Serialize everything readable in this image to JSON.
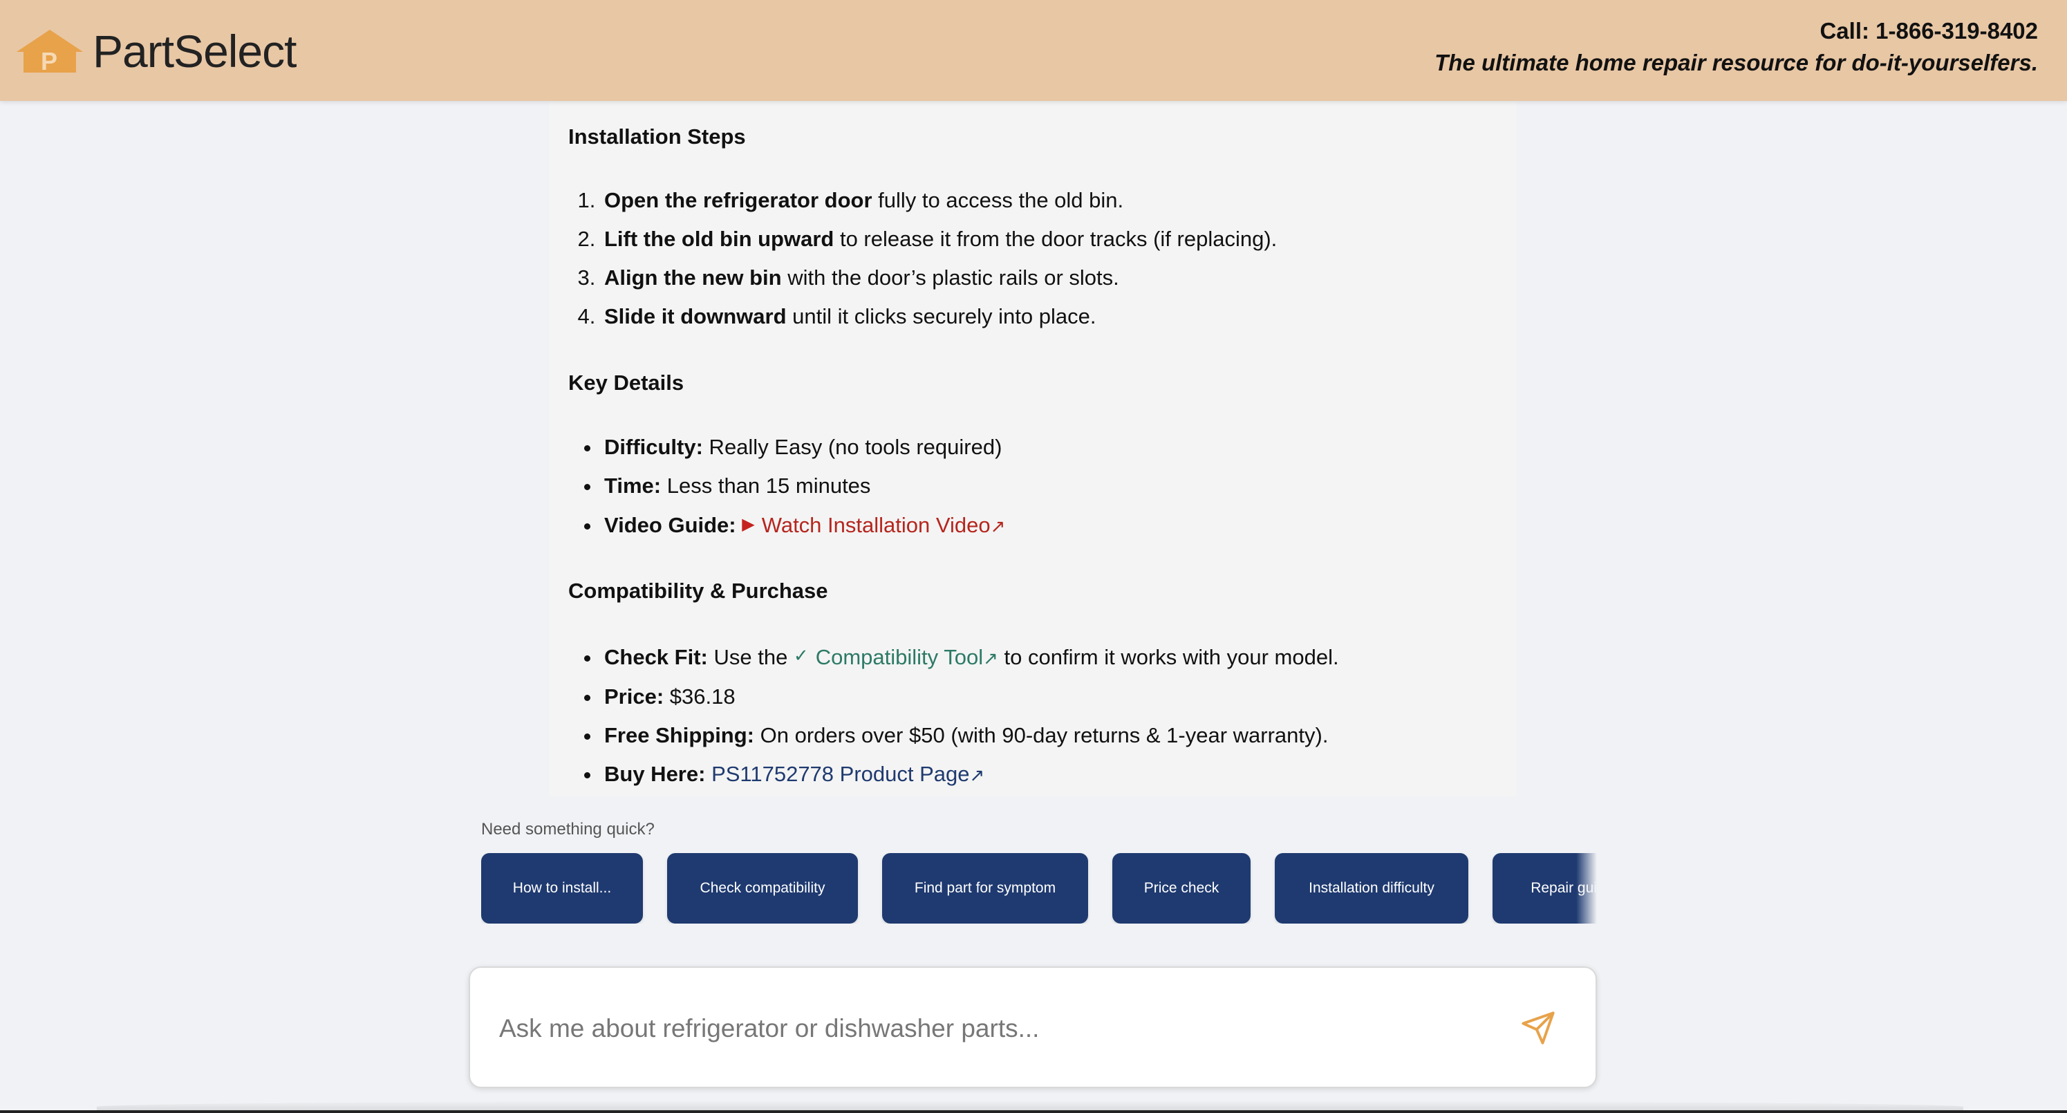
{
  "header": {
    "logo_text": "PartSelect",
    "logo_icon": "house-logo-icon",
    "call": "Call: 1-866-319-8402",
    "tagline": "The ultimate home repair resource for do-it-yourselfers."
  },
  "colors": {
    "header_bg": "#e8c7a5",
    "logo_orange": "#e8a24a",
    "chip_navy": "#1f3a70",
    "link_red": "#b5261e",
    "link_green": "#2d7a66",
    "send_orange": "#e8a24a"
  },
  "message": {
    "installation": {
      "heading": "Installation Steps",
      "steps": [
        {
          "bold": "Open the refrigerator door",
          "rest": " fully to access the old bin."
        },
        {
          "bold": "Lift the old bin upward",
          "rest": " to release it from the door tracks (if replacing)."
        },
        {
          "bold": "Align the new bin",
          "rest": " with the door’s plastic rails or slots."
        },
        {
          "bold": "Slide it downward",
          "rest": " until it clicks securely into place."
        }
      ]
    },
    "key_details": {
      "heading": "Key Details",
      "difficulty_label": "Difficulty:",
      "difficulty_value": " Really Easy (no tools required)",
      "time_label": "Time:",
      "time_value": " Less than 15 minutes",
      "video_label": "Video Guide:",
      "video_icon": "play-icon",
      "video_link": "Watch Installation Video",
      "external_icon": "↗"
    },
    "compatibility": {
      "heading": "Compatibility & Purchase",
      "fit_label": "Check Fit:",
      "fit_pre": " Use the ",
      "fit_icon": "checkmark-icon",
      "fit_link": "Compatibility Tool",
      "fit_post": " to confirm it works with your model.",
      "price_label": "Price:",
      "price_value": " $36.18",
      "shipping_label": "Free Shipping:",
      "shipping_value": " On orders over $50 (with 90-day returns & 1-year warranty).",
      "buy_label": "Buy Here:",
      "buy_link": "PS11752778 Product Page"
    }
  },
  "quick": {
    "label": "Need something quick?",
    "chips": [
      "How to install...",
      "Check compatibility",
      "Find part for symptom",
      "Price check",
      "Installation difficulty",
      "Repair guides"
    ]
  },
  "input": {
    "placeholder": "Ask me about refrigerator or dishwasher parts...",
    "value": "",
    "send_icon": "send-icon"
  }
}
